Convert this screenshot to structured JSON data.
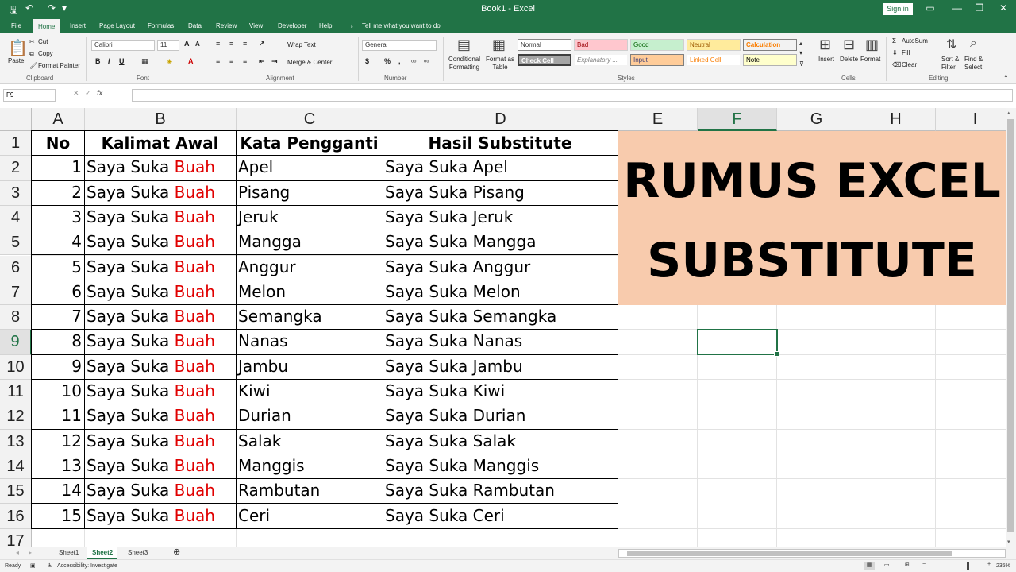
{
  "titlebar": {
    "title": "Book1  -  Excel",
    "signin": "Sign in"
  },
  "tabs": [
    "File",
    "Home",
    "Insert",
    "Page Layout",
    "Formulas",
    "Data",
    "Review",
    "View",
    "Developer",
    "Help"
  ],
  "tell_me": "Tell me what you want to do",
  "ribbon": {
    "clipboard": {
      "paste": "Paste",
      "cut": "Cut",
      "copy": "Copy",
      "format_painter": "Format Painter",
      "label": "Clipboard"
    },
    "font": {
      "name": "Calibri",
      "size": "11",
      "label": "Font"
    },
    "alignment": {
      "wrap": "Wrap Text",
      "merge": "Merge & Center",
      "label": "Alignment"
    },
    "number": {
      "format": "General",
      "label": "Number"
    },
    "styles": {
      "cond": "Conditional Formatting",
      "table": "Format as Table",
      "label": "Styles",
      "cells": [
        "Normal",
        "Bad",
        "Good",
        "Neutral",
        "Calculation",
        "Check Cell",
        "Explanatory ...",
        "Input",
        "Linked Cell",
        "Note"
      ]
    },
    "cells": {
      "insert": "Insert",
      "delete": "Delete",
      "format": "Format",
      "label": "Cells"
    },
    "editing": {
      "autosum": "AutoSum",
      "fill": "Fill",
      "clear": "Clear",
      "sort": "Sort & Filter",
      "find": "Find & Select",
      "label": "Editing"
    }
  },
  "formula_bar": {
    "name_box": "F9",
    "fx": "fx",
    "value": ""
  },
  "columns": [
    "A",
    "B",
    "C",
    "D",
    "E",
    "F",
    "G",
    "H",
    "I"
  ],
  "rows": [
    "1",
    "2",
    "3",
    "4",
    "5",
    "6",
    "7",
    "8",
    "9",
    "10",
    "11",
    "12",
    "13",
    "14",
    "15",
    "16",
    "17"
  ],
  "selected_cell": "F9",
  "table": {
    "headers": [
      "No",
      "Kalimat Awal",
      "Kata Pengganti",
      "Hasil Substitute"
    ],
    "prefix": "Saya Suka ",
    "highlight": "Buah",
    "rows": [
      [
        "1",
        "Apel",
        "Saya Suka Apel"
      ],
      [
        "2",
        "Pisang",
        "Saya Suka Pisang"
      ],
      [
        "3",
        "Jeruk",
        "Saya Suka Jeruk"
      ],
      [
        "4",
        "Mangga",
        "Saya Suka Mangga"
      ],
      [
        "5",
        "Anggur",
        "Saya Suka Anggur"
      ],
      [
        "6",
        "Melon",
        "Saya Suka Melon"
      ],
      [
        "7",
        "Semangka",
        "Saya Suka Semangka"
      ],
      [
        "8",
        "Nanas",
        "Saya Suka Nanas"
      ],
      [
        "9",
        "Jambu",
        "Saya Suka Jambu"
      ],
      [
        "10",
        "Kiwi",
        "Saya Suka Kiwi"
      ],
      [
        "11",
        "Durian",
        "Saya Suka Durian"
      ],
      [
        "12",
        "Salak",
        "Saya Suka Salak"
      ],
      [
        "13",
        "Manggis",
        "Saya Suka Manggis"
      ],
      [
        "14",
        "Rambutan",
        "Saya Suka Rambutan"
      ],
      [
        "15",
        "Ceri",
        "Saya Suka Ceri"
      ]
    ]
  },
  "banner": {
    "line1": "RUMUS EXCEL",
    "line2": "SUBSTITUTE",
    "bg": "#f8cbad"
  },
  "sheets": [
    "Sheet1",
    "Sheet2",
    "Sheet3"
  ],
  "active_sheet": "Sheet2",
  "status": {
    "ready": "Ready",
    "accessibility": "Accessibility: Investigate",
    "zoom": "235%"
  },
  "colors": {
    "excel_green": "#217346",
    "highlight_red": "#e00000"
  }
}
